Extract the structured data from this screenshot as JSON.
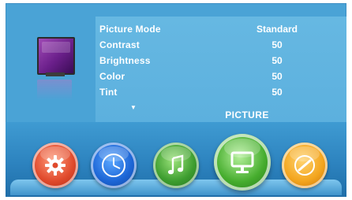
{
  "menu": {
    "section_title": "PICTURE",
    "settings": [
      {
        "label": "Picture Mode",
        "value": "Standard"
      },
      {
        "label": "Contrast",
        "value": "50"
      },
      {
        "label": "Brightness",
        "value": "50"
      },
      {
        "label": "Color",
        "value": "50"
      },
      {
        "label": "Tint",
        "value": "50"
      }
    ],
    "more_indicator": "▼"
  },
  "nav": {
    "items": [
      {
        "name": "settings",
        "icon": "gear-icon",
        "color": "#e04a2c"
      },
      {
        "name": "time",
        "icon": "clock-icon",
        "color": "#1d66d6"
      },
      {
        "name": "audio",
        "icon": "music-note-icon",
        "color": "#3d9d2f"
      },
      {
        "name": "picture",
        "icon": "monitor-icon",
        "color": "#46ad2e",
        "selected": true
      },
      {
        "name": "options",
        "icon": "wrench-icon",
        "color": "#f3a51e"
      }
    ]
  },
  "colors": {
    "panel": "#4aa3d6",
    "panel_inner": "#5cb0de",
    "tray": "#2d83bf",
    "text": "#ffffff"
  }
}
